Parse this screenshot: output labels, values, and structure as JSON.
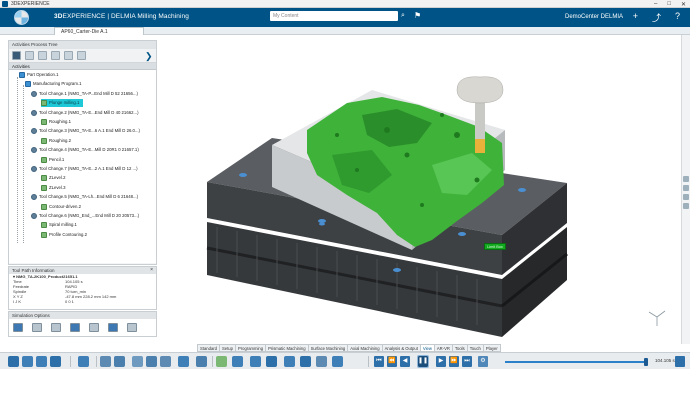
{
  "os_bar": {
    "app_name": "3DEXPERIENCE",
    "buttons": [
      "–",
      "□",
      "✕"
    ]
  },
  "header": {
    "brand_bold": "3D",
    "brand_rest": "EXPERIENCE | DELMIA",
    "app": "Milling Machining",
    "search_placeholder": "My Content",
    "space": "DemoCenter DELMIA",
    "icons": [
      "plus-icon",
      "share-icon",
      "help-icon"
    ]
  },
  "document_tab": "AP60_Carter-Die A.1",
  "tree_panel": {
    "title": "Activities Process Tree",
    "column_header": "Activities",
    "rows": [
      {
        "label": "Part Operation.1",
        "depth": 0,
        "kind": "op"
      },
      {
        "label": "Manufacturing Program.1",
        "depth": 1,
        "kind": "op"
      },
      {
        "label": "Tool Change.1 (NMG_TA-P...End Mill D 52 21656...)",
        "depth": 2,
        "kind": "tool"
      },
      {
        "label": "Plunge milling.1",
        "depth": 3,
        "kind": "g",
        "selected": true
      },
      {
        "label": "Tool Change.2 (NMG_TA-E...End Mill D 40 21662...)",
        "depth": 2,
        "kind": "tool"
      },
      {
        "label": "Roughing.1",
        "depth": 3,
        "kind": "g"
      },
      {
        "label": "Tool Change.3 (NMG_TA-E...6 A.1 End Mill D 26.0...)",
        "depth": 2,
        "kind": "tool"
      },
      {
        "label": "Roughing.2",
        "depth": 3,
        "kind": "g"
      },
      {
        "label": "Tool Change.4 (NMG_TA-E...Mill D 20R1 0 21657.1)",
        "depth": 2,
        "kind": "tool"
      },
      {
        "label": "Pencil.1",
        "depth": 3,
        "kind": "g"
      },
      {
        "label": "Tool Change.7 (NMG_TA-E...2 A.1 End Mill D 12 ...)",
        "depth": 2,
        "kind": "tool"
      },
      {
        "label": "ZLevel.2",
        "depth": 3,
        "kind": "g"
      },
      {
        "label": "ZLevel.3",
        "depth": 3,
        "kind": "g"
      },
      {
        "label": "Tool Change.5 (NMG_TA-Lh...End Mill D 6 21648...)",
        "depth": 2,
        "kind": "tool"
      },
      {
        "label": "Contour-driven.2",
        "depth": 3,
        "kind": "g"
      },
      {
        "label": "Tool Change.6 (NMG_End_...End Mill D 20 20573...)",
        "depth": 2,
        "kind": "tool"
      },
      {
        "label": "Spiral milling.1",
        "depth": 3,
        "kind": "g"
      },
      {
        "label": "Profile Contouring.2",
        "depth": 3,
        "kind": "g"
      }
    ]
  },
  "tool_path_info": {
    "title": "Tool Path Information",
    "close": "×",
    "heading": "▾ NMG_TA-2K100_Product21651.1",
    "rows": [
      {
        "k": "Time",
        "v": "104.105 s"
      },
      {
        "k": "Feedrate",
        "v": "RAPID"
      },
      {
        "k": "Spindle",
        "v": "70 turn_min"
      },
      {
        "k": "X  Y  Z",
        "v": "-47.8 mm  228.2 mm  142 mm"
      },
      {
        "k": "I  J  K",
        "v": "0  0  1"
      }
    ]
  },
  "simulation_options": {
    "title": "Simulation Options"
  },
  "viewport": {
    "annotation": "Limit Box"
  },
  "section_tabs": [
    {
      "label": "Standard",
      "active": false
    },
    {
      "label": "Setup",
      "active": false
    },
    {
      "label": "Programming",
      "active": false
    },
    {
      "label": "Prismatic Machining",
      "active": false
    },
    {
      "label": "Surface Machining",
      "active": false
    },
    {
      "label": "Axial Machining",
      "active": false
    },
    {
      "label": "Analysis & Output",
      "active": false
    },
    {
      "label": "View",
      "active": true
    },
    {
      "label": "AR-VR",
      "active": false
    },
    {
      "label": "Tools",
      "active": false
    },
    {
      "label": "Touch",
      "active": false
    },
    {
      "label": "Player",
      "active": false
    }
  ],
  "player": {
    "speed_label": "104.105 s",
    "progress": 1.0
  },
  "colors": {
    "brand": "#005386",
    "selection": "#1ec8d6",
    "stock_green": "#34b535",
    "machine_dark": "#3a3d40"
  }
}
